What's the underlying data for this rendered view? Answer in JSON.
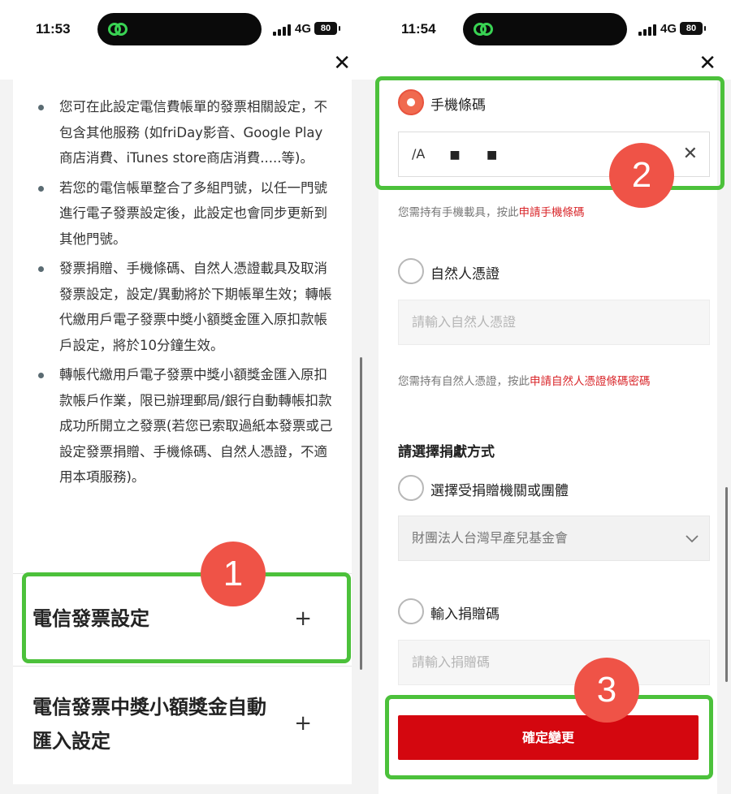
{
  "left": {
    "status": {
      "time": "11:53",
      "network": "4G",
      "battery": "80"
    },
    "notes": [
      "您可在此設定電信費帳單的發票相關設定，不包含其他服務 (如friDay影音、Google Play商店消費、iTunes store商店消費.....等)。",
      "若您的電信帳單整合了多組門號，以任一門號進行電子發票設定後，此設定也會同步更新到其他門號。",
      "發票捐贈、手機條碼、自然人憑證載具及取消發票設定，設定/異動將於下期帳單生效；轉帳代繳用戶電子發票中獎小額獎金匯入原扣款帳戶設定，將於10分鐘生效。",
      "轉帳代繳用戶電子發票中獎小額獎金匯入原扣款帳戶作業，限已辦理郵局/銀行自動轉帳扣款成功所開立之發票(若您已索取過紙本發票或己設定發票捐贈、手機條碼、自然人憑證，不適用本項服務)。"
    ],
    "accordion1": {
      "title": "電信發票設定",
      "icon": "+"
    },
    "accordion2": {
      "title_line1": "電信發票中獎小額獎金自動",
      "title_line2": "匯入設定",
      "icon": "+"
    },
    "badge": "1"
  },
  "right": {
    "status": {
      "time": "11:54",
      "network": "4G",
      "battery": "80"
    },
    "mobile_barcode": {
      "label": "手機條碼",
      "value": "/A",
      "masked": "■ ■",
      "hint_prefix": "您需持有手機載具，按此",
      "hint_link": "申請手機條碼"
    },
    "citizen_cert": {
      "label": "自然人憑證",
      "placeholder": "請輸入自然人憑證",
      "hint_prefix": "您需持有自然人憑證，按此",
      "hint_link": "申請自然人憑證條碼密碼"
    },
    "donation": {
      "section_title": "請選擇捐獻方式",
      "option1_label": "選擇受捐贈機關或團體",
      "selected_org": "財團法人台灣早產兒基金會",
      "option2_label": "輸入捐贈碼",
      "code_placeholder": "請輸入捐贈碼"
    },
    "confirm_label": "確定變更",
    "badge2": "2",
    "badge3": "3"
  },
  "colors": {
    "highlight": "#4cc13b",
    "badge": "#ef5347",
    "accent": "#d4070f",
    "radio_on": "#f06a4f"
  }
}
